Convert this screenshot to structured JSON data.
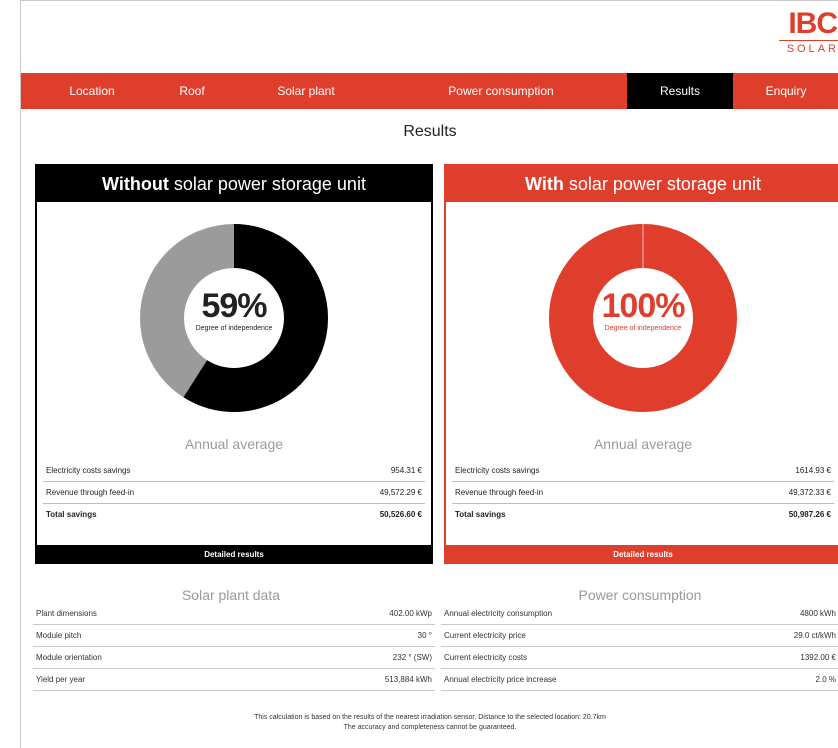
{
  "brand": {
    "name": "IBC",
    "sub": "SOLAR",
    "accent": "#e03e2d"
  },
  "nav": {
    "items": [
      {
        "label": "Location",
        "active": false
      },
      {
        "label": "Roof",
        "active": false
      },
      {
        "label": "Solar plant",
        "active": false
      },
      {
        "label": "Power consumption",
        "active": false
      },
      {
        "label": "Results",
        "active": true
      },
      {
        "label": "Enquiry",
        "active": false
      }
    ]
  },
  "page": {
    "title": "Results"
  },
  "without": {
    "title_bold": "Without",
    "title_rest": " solar power storage unit",
    "independence": "59%",
    "independence_value": 59,
    "donut_label": "Degree of independence",
    "avg_label": "Annual average",
    "rows": [
      {
        "label": "Electricity costs savings",
        "value": "954.31 €"
      },
      {
        "label": "Revenue through feed-in",
        "value": "49,572.29 €"
      }
    ],
    "total": {
      "label": "Total savings",
      "value": "50,526.60 €"
    },
    "button": "Detailed results"
  },
  "with": {
    "title_bold": "With",
    "title_rest": " solar power storage unit",
    "independence": "100%",
    "independence_value": 100,
    "donut_label": "Degree of independence",
    "avg_label": "Annual average",
    "rows": [
      {
        "label": "Electricity costs savings",
        "value": "1614.93 €"
      },
      {
        "label": "Revenue through feed-in",
        "value": "49,372.33 €"
      }
    ],
    "total": {
      "label": "Total savings",
      "value": "50,987.26 €"
    },
    "button": "Detailed results"
  },
  "solar_plant": {
    "title": "Solar plant data",
    "rows": [
      {
        "label": "Plant dimensions",
        "value": "402.00 kWp"
      },
      {
        "label": "Module pitch",
        "value": "30 °"
      },
      {
        "label": "Module orientation",
        "value": "232 ° (SW)"
      },
      {
        "label": "Yield per year",
        "value": "513,884 kWh"
      }
    ]
  },
  "power_consumption": {
    "title": "Power consumption",
    "rows": [
      {
        "label": "Annual electricity consumption",
        "value": "4800 kWh"
      },
      {
        "label": "Current electricity price",
        "value": "29.0 ct/kWh"
      },
      {
        "label": "Current electricity costs",
        "value": "1392.00 €"
      },
      {
        "label": "Annual electricity price increase",
        "value": "2.0 %"
      }
    ]
  },
  "footer": {
    "line1": "This calculation is based on the results of the nearest irradiation sensor. Distance to the selected location: 20.7km",
    "line2": "The accuracy and completeness cannot be guaranteed."
  }
}
